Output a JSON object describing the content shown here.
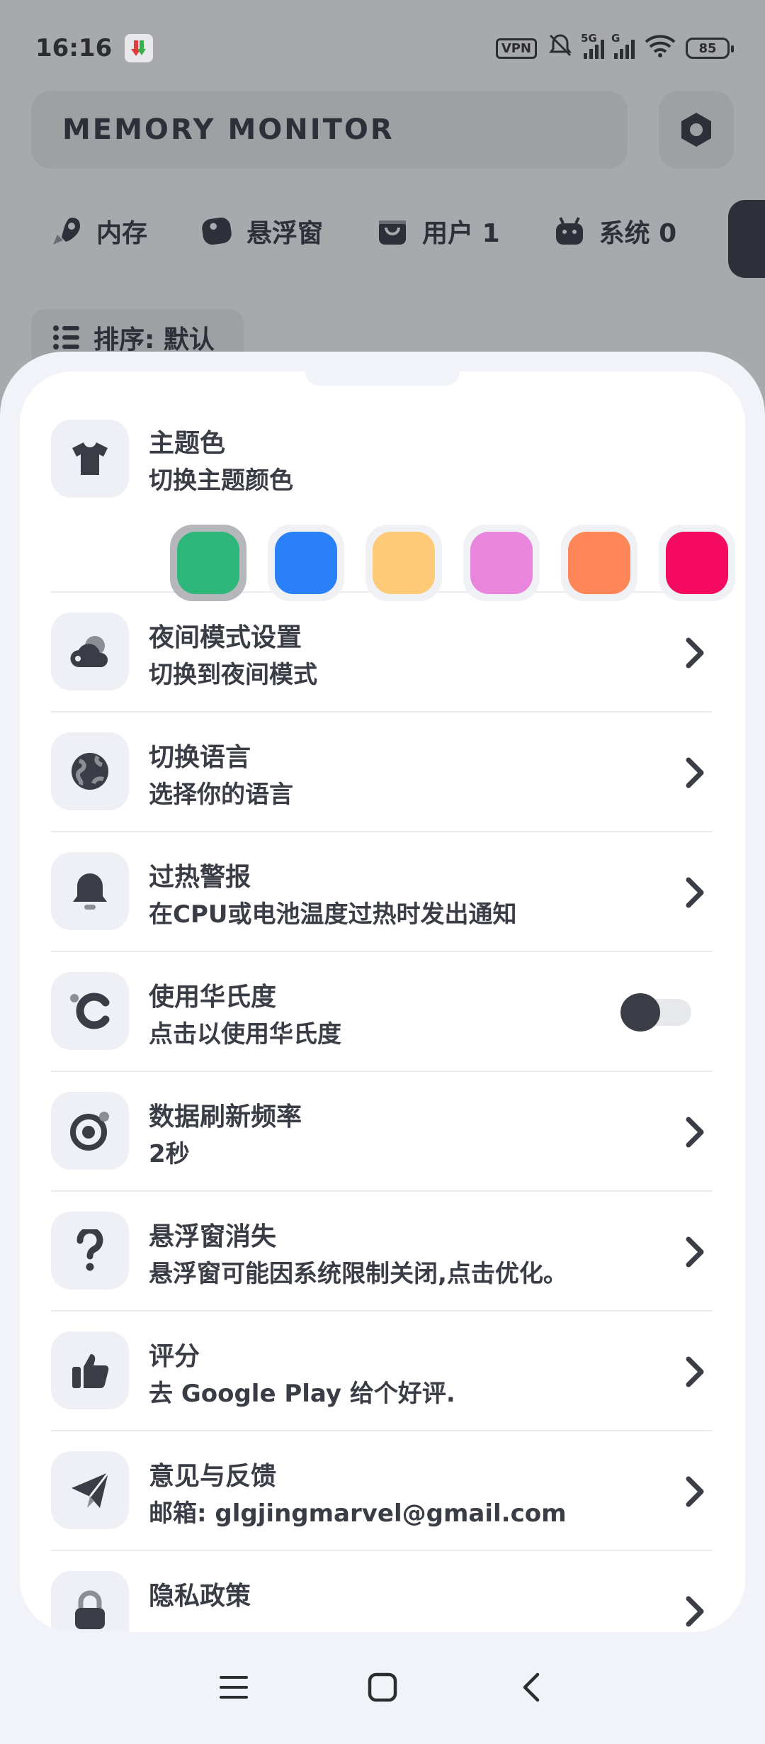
{
  "status_bar": {
    "time": "16:16",
    "vpn": "VPN",
    "sim1": "5G",
    "sim2": "G",
    "battery": "85",
    "icons": [
      "notification-app-icon",
      "silent-bell-icon",
      "signal-icon",
      "wifi-icon",
      "battery-icon"
    ]
  },
  "app": {
    "title": "MEMORY MONITOR",
    "settings_icon": "hexagon-icon"
  },
  "tabs": [
    {
      "label": "内存",
      "icon": "rocket-icon"
    },
    {
      "label": "悬浮窗",
      "icon": "floating-window-icon"
    },
    {
      "label": "用户 1",
      "icon": "shopping-bag-icon"
    },
    {
      "label": "系统 0",
      "icon": "android-icon"
    }
  ],
  "sort": {
    "label": "排序: 默认",
    "icon": "list-icon"
  },
  "settings": {
    "theme": {
      "title": "主题色",
      "subtitle": "切换主题颜色",
      "icon": "tshirt-icon",
      "colors": [
        "#2fb67a",
        "#2a80f8",
        "#ffca78",
        "#e985dc",
        "#ff8656",
        "#f40a5e"
      ],
      "selected_index": 0
    },
    "rows": [
      {
        "title": "夜间模式设置",
        "subtitle": "切换到夜间模式",
        "icon": "night-cloud-icon",
        "control": "chevron"
      },
      {
        "title": "切换语言",
        "subtitle": "选择你的语言",
        "icon": "globe-icon",
        "control": "chevron"
      },
      {
        "title": "过热警报",
        "subtitle": "在CPU或电池温度过热时发出通知",
        "icon": "bell-icon",
        "control": "chevron"
      },
      {
        "title": "使用华氏度",
        "subtitle": "点击以使用华氏度",
        "icon": "fahrenheit-icon",
        "control": "toggle",
        "toggle_on": false
      },
      {
        "title": "数据刷新频率",
        "subtitle": "2秒",
        "icon": "refresh-rate-icon",
        "control": "chevron"
      },
      {
        "title": "悬浮窗消失",
        "subtitle": "悬浮窗可能因系统限制关闭,点击优化。",
        "icon": "question-icon",
        "control": "chevron"
      },
      {
        "title": "评分",
        "subtitle": "去 Google Play 给个好评.",
        "icon": "thumbs-up-icon",
        "control": "chevron"
      },
      {
        "title": "意见与反馈",
        "subtitle": "邮箱: glgjingmarvel@gmail.com",
        "icon": "paper-plane-icon",
        "control": "chevron"
      },
      {
        "title": "隐私政策",
        "subtitle": "",
        "icon": "lock-icon",
        "control": "chevron"
      }
    ]
  },
  "navigation": {
    "buttons": [
      "menu-icon",
      "home-square-icon",
      "back-icon"
    ]
  },
  "colors": {
    "accent": "#2fb67a",
    "text": "#3a3d45",
    "sheet_bg": "#f1f3f8"
  }
}
